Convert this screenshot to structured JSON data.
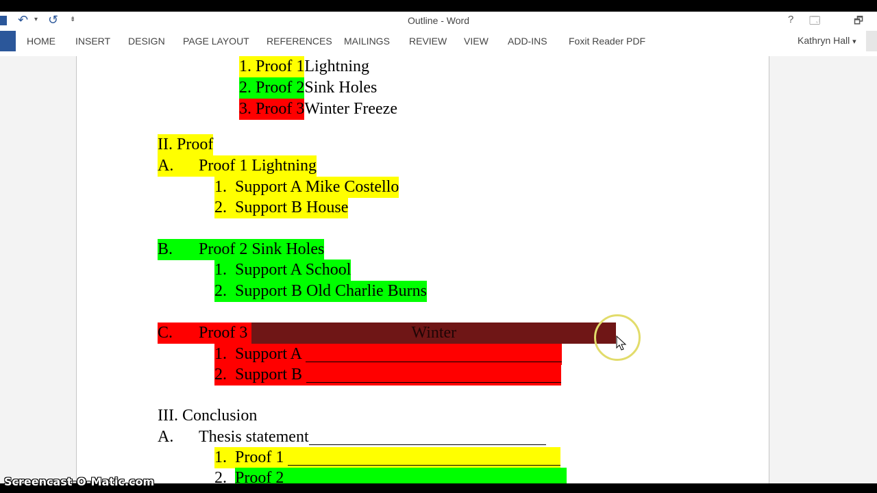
{
  "window": {
    "title": "Outline - Word",
    "help": "?",
    "controls": [
      "🗔",
      "🗗"
    ]
  },
  "qat": {
    "undo_icon": "undo-icon",
    "undo_arrow": "↶",
    "undo_dropdown": "▾",
    "redo_icon": "redo-icon",
    "redo_arrow": "↺",
    "customize": "⇟"
  },
  "ribbon": {
    "tabs": [
      "HOME",
      "INSERT",
      "DESIGN",
      "PAGE LAYOUT",
      "REFERENCES",
      "MAILINGS",
      "REVIEW",
      "VIEW",
      "ADD-INS",
      "Foxit Reader PDF"
    ],
    "user": "Kathryn Hall",
    "user_dropdown": "▾"
  },
  "document": {
    "intro_list": [
      {
        "num": "1.",
        "label": "Proof 1",
        "text": "Lightning",
        "color": "#ffff00"
      },
      {
        "num": "2.",
        "label": "Proof 2",
        "text": "Sink Holes",
        "color": "#00ff00"
      },
      {
        "num": "3.",
        "label": "Proof 3",
        "text": "Winter Freeze",
        "color": "#ff0000"
      }
    ],
    "section2": {
      "heading": "II. Proof",
      "a": {
        "letter": "A.",
        "text": "Proof 1 Lightning"
      },
      "a_supports": [
        {
          "num": "1.",
          "text": "Support A Mike Costello"
        },
        {
          "num": "2.",
          "text": "Support B House"
        }
      ],
      "b": {
        "letter": "B.",
        "text": "Proof 2 Sink Holes"
      },
      "b_supports": [
        {
          "num": "1.",
          "text": "Support A School"
        },
        {
          "num": "2.",
          "text": "Support B Old Charlie Burns"
        }
      ],
      "c": {
        "letter": "C.",
        "text": "Proof 3",
        "selected_text": "Winter"
      },
      "c_supports": [
        {
          "num": "1.",
          "text": "Support A"
        },
        {
          "num": "2.",
          "text": "Support B"
        }
      ]
    },
    "section3": {
      "heading": "III. Conclusion",
      "a": {
        "letter": "A.",
        "text": "Thesis statement"
      },
      "proofs": [
        {
          "num": "1.",
          "text": "Proof 1"
        },
        {
          "num": "2.",
          "text": "Proof 2"
        }
      ]
    }
  },
  "colors": {
    "yellow": "#ffff00",
    "green": "#00ff00",
    "red": "#ff0000",
    "selection": "#6f1616",
    "word_blue": "#2b579a"
  },
  "watermark": "Screencast-O-Matic.com"
}
